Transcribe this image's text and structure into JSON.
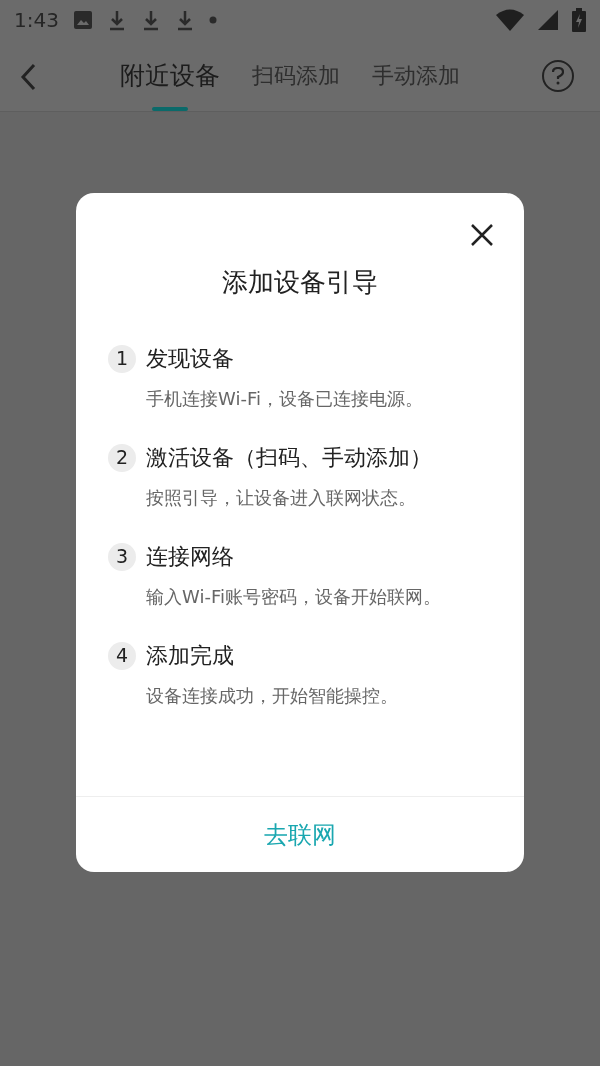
{
  "status_bar": {
    "time": "1:43"
  },
  "nav": {
    "tabs": [
      {
        "label": "附近设备",
        "selected": true
      },
      {
        "label": "扫码添加",
        "selected": false
      },
      {
        "label": "手动添加",
        "selected": false
      }
    ]
  },
  "dialog": {
    "title": "添加设备引导",
    "steps": [
      {
        "number": "1",
        "title": "发现设备",
        "description": "手机连接Wi-Fi，设备已连接电源。"
      },
      {
        "number": "2",
        "title": "激活设备（扫码、手动添加）",
        "description": "按照引导，让设备进入联网状态。"
      },
      {
        "number": "3",
        "title": "连接网络",
        "description": "输入Wi-Fi账号密码，设备开始联网。"
      },
      {
        "number": "4",
        "title": "添加完成",
        "description": "设备连接成功，开始智能操控。"
      }
    ],
    "action": "去联网"
  }
}
